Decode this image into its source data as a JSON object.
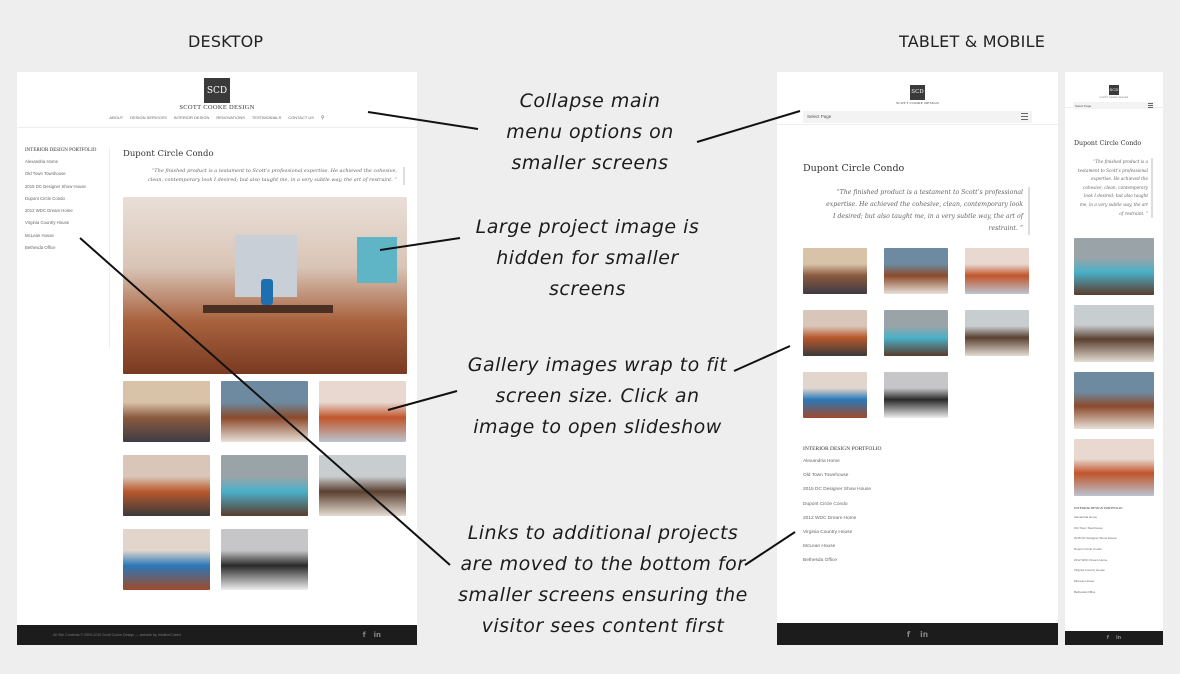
{
  "labels": {
    "desktop": "DESKTOP",
    "tablet_mobile": "TABLET & MOBILE"
  },
  "site": {
    "brand": "SCOTT COOKE DESIGN",
    "logo_letters": "SCD",
    "nav": [
      "ABOUT",
      "DESIGN SERVICES",
      "INTERIOR DESIGN",
      "RENOVATIONS",
      "TESTIMONIALS",
      "CONTACT US"
    ],
    "search_icon": "search-icon",
    "select_page": "Select Page",
    "menu_icon": "hamburger-menu-icon",
    "page_title": "Dupont Circle Condo",
    "quote": "“The finished product is a testament to Scott’s professional expertise. He achieved the cohesive, clean, contemporary look I desired; but also taught me, in a very subtle way, the art of restraint. ”",
    "portfolio_heading": "INTERIOR DESIGN PORTFOLIO",
    "portfolio_links": [
      "Alexandria Home",
      "Old Town Townhouse",
      "2015 DC Designer Show House",
      "Dupont Circle Condo",
      "2012 WDC Dream Home",
      "Virginia Country House",
      "McLean House",
      "Bethesda Office"
    ],
    "footer_text": "All Site Contents © 2009-2016 Scott Cooke Design — website by IntuitiveCubed",
    "social": {
      "facebook": "f",
      "linkedin": "in"
    },
    "gallery": [
      {
        "name": "living-room-fireplace",
        "colors": [
          "#d8c2a8",
          "#8a5a3e",
          "#3e3b45"
        ]
      },
      {
        "name": "open-living-area",
        "colors": [
          "#6d8aa0",
          "#8b4a2c",
          "#e8e0d8"
        ]
      },
      {
        "name": "kitchen-view",
        "colors": [
          "#e8d8d0",
          "#c0552a",
          "#bcc3cf"
        ]
      },
      {
        "name": "kitchen-cabinets",
        "colors": [
          "#d9c6b8",
          "#b8582c",
          "#3a3a3a"
        ]
      },
      {
        "name": "dining-art-wall",
        "colors": [
          "#9aa4a8",
          "#4ab0c8",
          "#5a3c2c"
        ]
      },
      {
        "name": "sunroom-dining",
        "colors": [
          "#c8ced0",
          "#5a4030",
          "#e4dcd2"
        ]
      },
      {
        "name": "dining-room",
        "colors": [
          "#e2d6cc",
          "#2a78b8",
          "#a04a2a"
        ]
      },
      {
        "name": "hallway-gallery",
        "colors": [
          "#c6c6c8",
          "#2a2a2a",
          "#eeeeee"
        ]
      }
    ],
    "hero_image": "dining-room-large"
  },
  "annotations": [
    "Collapse main menu options on smaller screens",
    "Large project image is hidden for smaller screens",
    "Gallery images wrap to fit screen size. Click an image to open slideshow",
    "Links to additional projects are moved to the bottom for smaller screens ensuring the visitor sees content first"
  ]
}
